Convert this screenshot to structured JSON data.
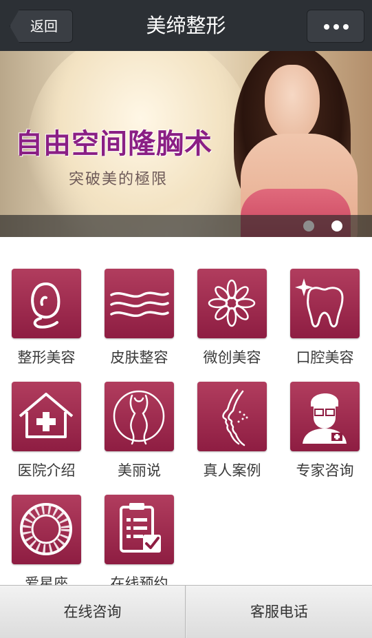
{
  "nav": {
    "back_label": "返回",
    "title": "美缔整形",
    "more_icon": "more-dots-icon"
  },
  "banner": {
    "headline": "自由空间隆胸术",
    "subline": "突破美的極限",
    "slide_count": 2,
    "active_slide": 2
  },
  "menu": [
    {
      "label": "整形美容",
      "icon": "face-profile-icon"
    },
    {
      "label": "皮肤整容",
      "icon": "skin-waves-icon"
    },
    {
      "label": "微创美容",
      "icon": "flower-icon"
    },
    {
      "label": "口腔美容",
      "icon": "tooth-icon"
    },
    {
      "label": "医院介绍",
      "icon": "hospital-house-icon"
    },
    {
      "label": "美丽说",
      "icon": "woman-silhouette-icon"
    },
    {
      "label": "真人案例",
      "icon": "face-side-icon"
    },
    {
      "label": "专家咨询",
      "icon": "doctor-icon"
    },
    {
      "label": "爱星座",
      "icon": "zodiac-wheel-icon"
    },
    {
      "label": "在线预约",
      "icon": "clipboard-check-icon"
    }
  ],
  "bottom": {
    "consult_label": "在线咨询",
    "phone_label": "客服电话"
  },
  "colors": {
    "nav_bg": "#2c3035",
    "tile_top": "#b13d5e",
    "tile_bottom": "#8e1d42",
    "headline": "#8a1f84"
  }
}
